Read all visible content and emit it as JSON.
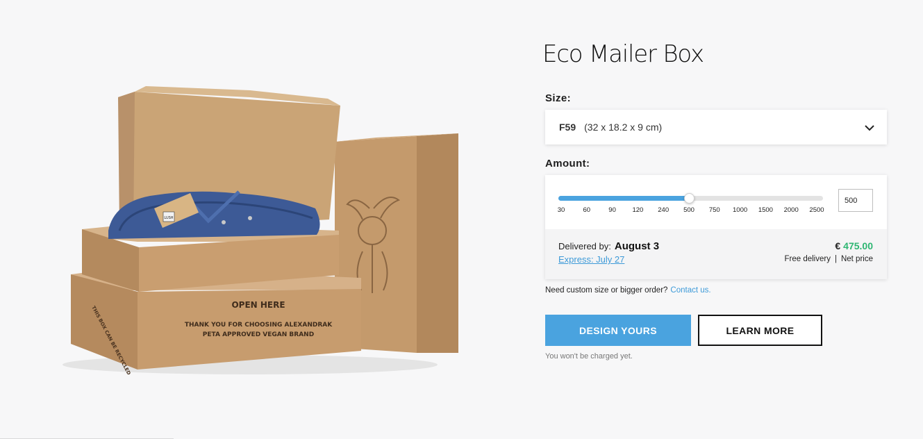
{
  "product": {
    "title": "Eco Mailer Box",
    "image_alt": "Eco Mailer Box product photo",
    "box_print": {
      "line1": "OPEN HERE",
      "line2": "THANK YOU FOR CHOOSING ALEXANDRAK",
      "line3": "PETA APPROVED VEGAN BRAND",
      "side": "THIS BOX CAN BE RECYCLED",
      "tag": "LUSH"
    }
  },
  "size": {
    "label": "Size:",
    "code": "F59",
    "dimensions": "(32 x 18.2 x 9 cm)",
    "icon": "chevron-down-icon"
  },
  "amount": {
    "label": "Amount:",
    "ticks": [
      "30",
      "60",
      "90",
      "120",
      "240",
      "500",
      "750",
      "1000",
      "1500",
      "2000",
      "2500"
    ],
    "selected_index": 5,
    "value": "500",
    "accent_color": "#4aa3df"
  },
  "delivery": {
    "delivered_by_label": "Delivered by:",
    "date": "August 3",
    "express": "Express: July 27",
    "currency": "€",
    "price": "475.00",
    "price_color": "#2eb672",
    "free_delivery": "Free delivery",
    "separator": "|",
    "net_price": "Net price"
  },
  "custom": {
    "text": "Need custom size or bigger order?",
    "link": "Contact us."
  },
  "actions": {
    "design": "DESIGN YOURS",
    "learn": "LEARN MORE",
    "note": "You won't be charged yet."
  }
}
